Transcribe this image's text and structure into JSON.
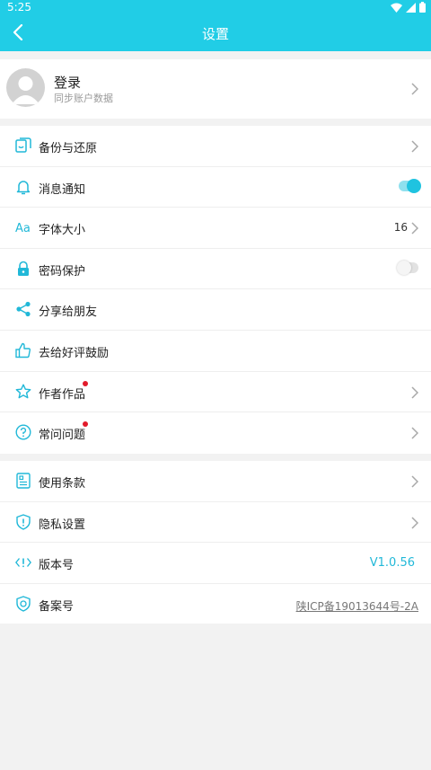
{
  "status_bar": {
    "time": "5:25",
    "icons": [
      "wifi-icon",
      "signal-icon",
      "battery-icon"
    ]
  },
  "header": {
    "title": "设置",
    "back_icon": "back-arrow-icon"
  },
  "profile": {
    "name": "登录",
    "subtitle": "同步账户数据"
  },
  "group1": {
    "items": [
      {
        "label": "备份与还原",
        "icon": "backup-icon"
      },
      {
        "label": "消息通知",
        "icon": "bell-icon",
        "toggle": true
      },
      {
        "label": "字体大小",
        "icon": "font-size-icon",
        "value": "16"
      },
      {
        "label": "密码保护",
        "icon": "lock-icon",
        "toggle": false
      },
      {
        "label": "分享给朋友",
        "icon": "share-icon"
      },
      {
        "label": "去给好评鼓励",
        "icon": "thumb-up-icon"
      },
      {
        "label": "作者作品",
        "icon": "star-icon",
        "badge": true
      },
      {
        "label": "常问问题",
        "icon": "question-icon",
        "badge": true
      }
    ]
  },
  "group2": {
    "items": [
      {
        "label": "使用条款",
        "icon": "document-icon"
      },
      {
        "label": "隐私设置",
        "icon": "shield-icon"
      },
      {
        "label": "版本号",
        "icon": "version-icon",
        "value": "V1.0.56"
      },
      {
        "label": "备案号",
        "icon": "record-icon",
        "value": "陕ICP备19013644号-2A"
      }
    ]
  },
  "colors": {
    "accent": "#21cde6",
    "icon": "#21b8d8",
    "badge": "#e21b2b",
    "background": "#f2f2f2"
  }
}
